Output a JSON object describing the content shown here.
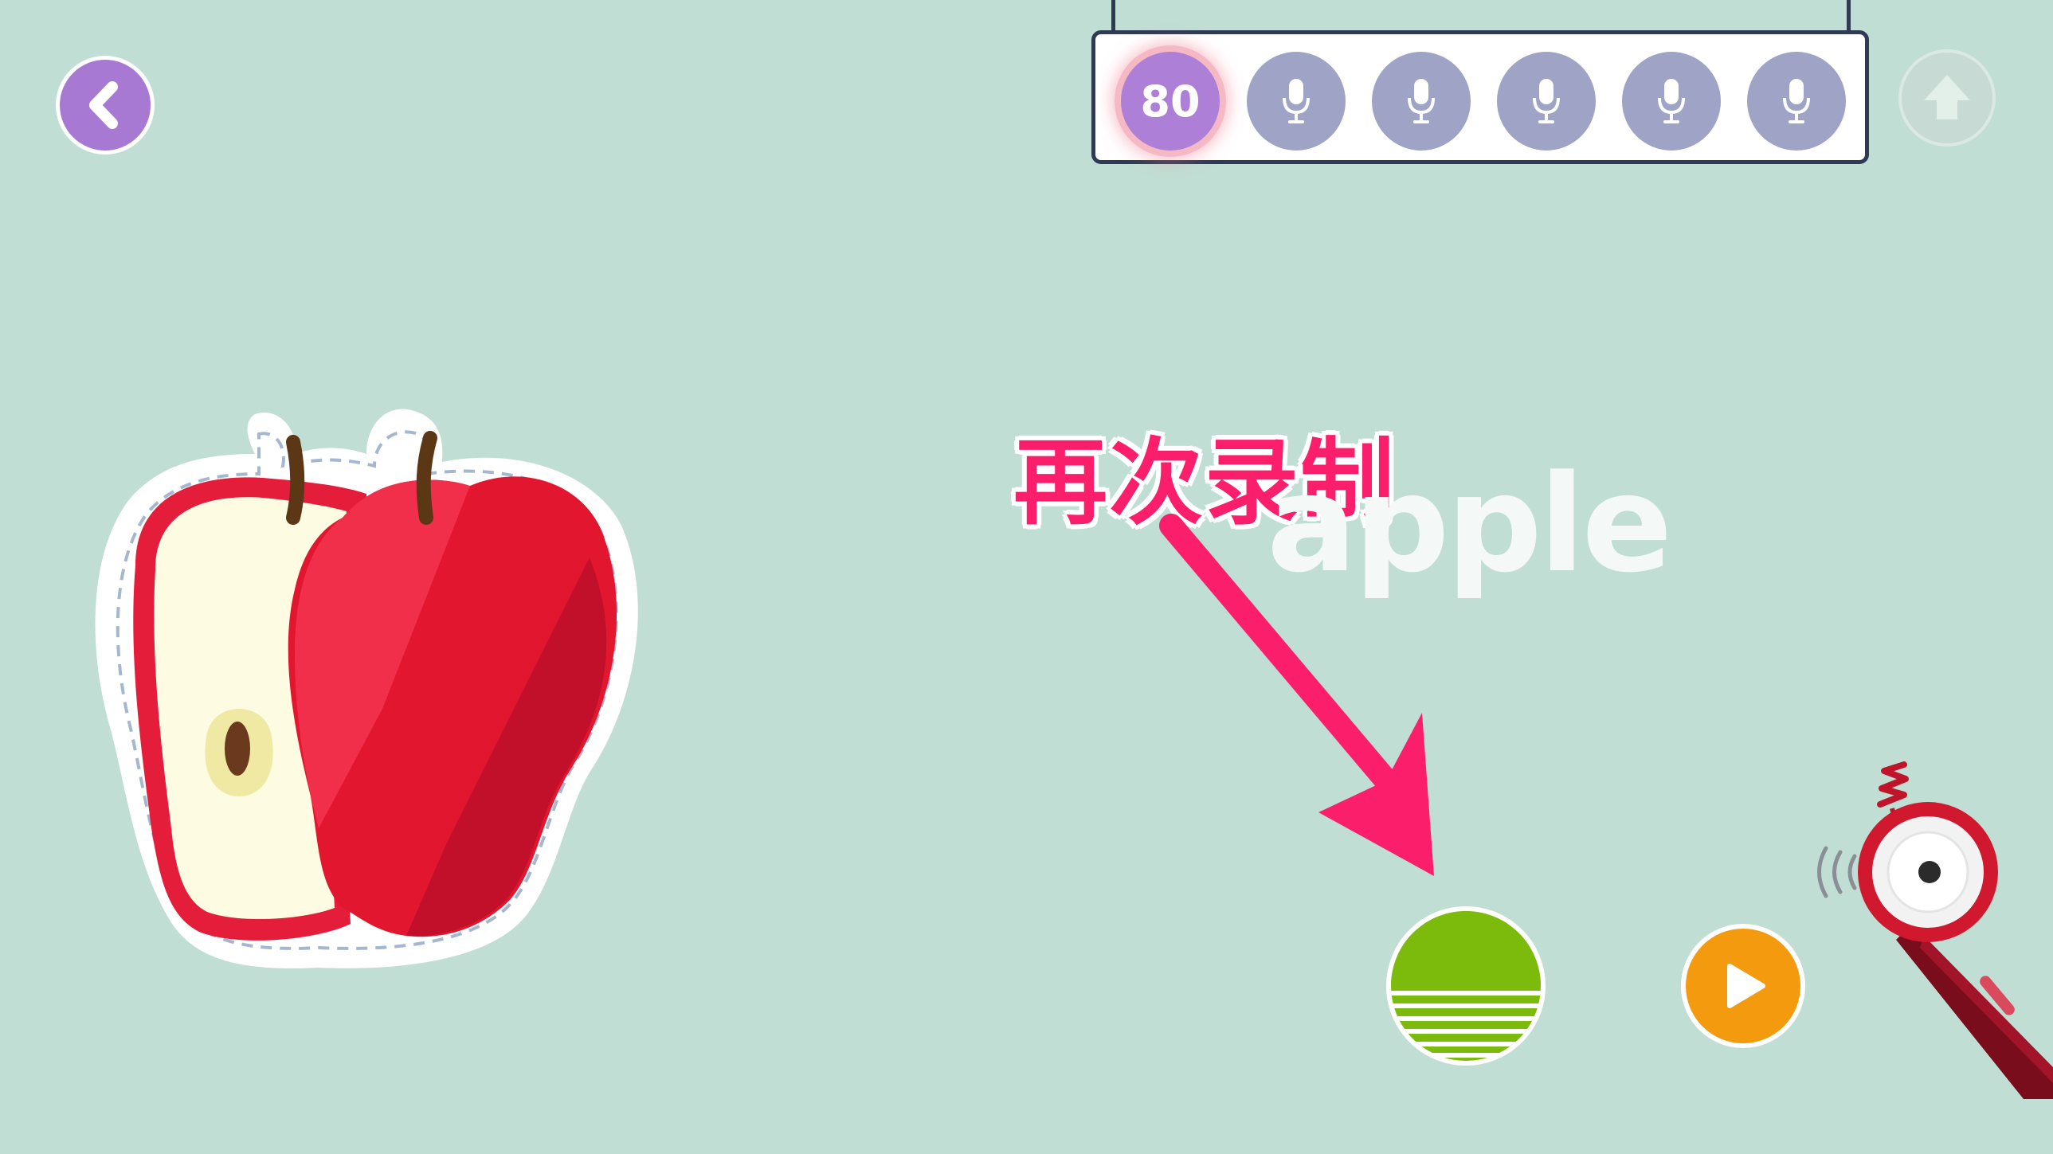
{
  "score_board": {
    "score": "80",
    "slots": [
      {
        "state": "scored",
        "icon": "score-badge"
      },
      {
        "state": "pending",
        "icon": "microphone-icon"
      },
      {
        "state": "pending",
        "icon": "microphone-icon"
      },
      {
        "state": "pending",
        "icon": "microphone-icon"
      },
      {
        "state": "pending",
        "icon": "microphone-icon"
      },
      {
        "state": "pending",
        "icon": "microphone-icon"
      }
    ]
  },
  "main": {
    "word": "apple",
    "image": "apple-illustration"
  },
  "annotation": {
    "label": "再次录制",
    "color": "#fb1f6b"
  },
  "controls": {
    "back_icon": "chevron-left-icon",
    "upload_icon": "up-arrow-icon",
    "record_icon": "record-button-icon",
    "play_icon": "play-icon"
  },
  "colors": {
    "background": "#c1ded4",
    "accent_purple": "#a779d2",
    "record_green": "#7cbb0c",
    "play_orange": "#f39a0e",
    "slot_gray": "#9fa4c6"
  }
}
